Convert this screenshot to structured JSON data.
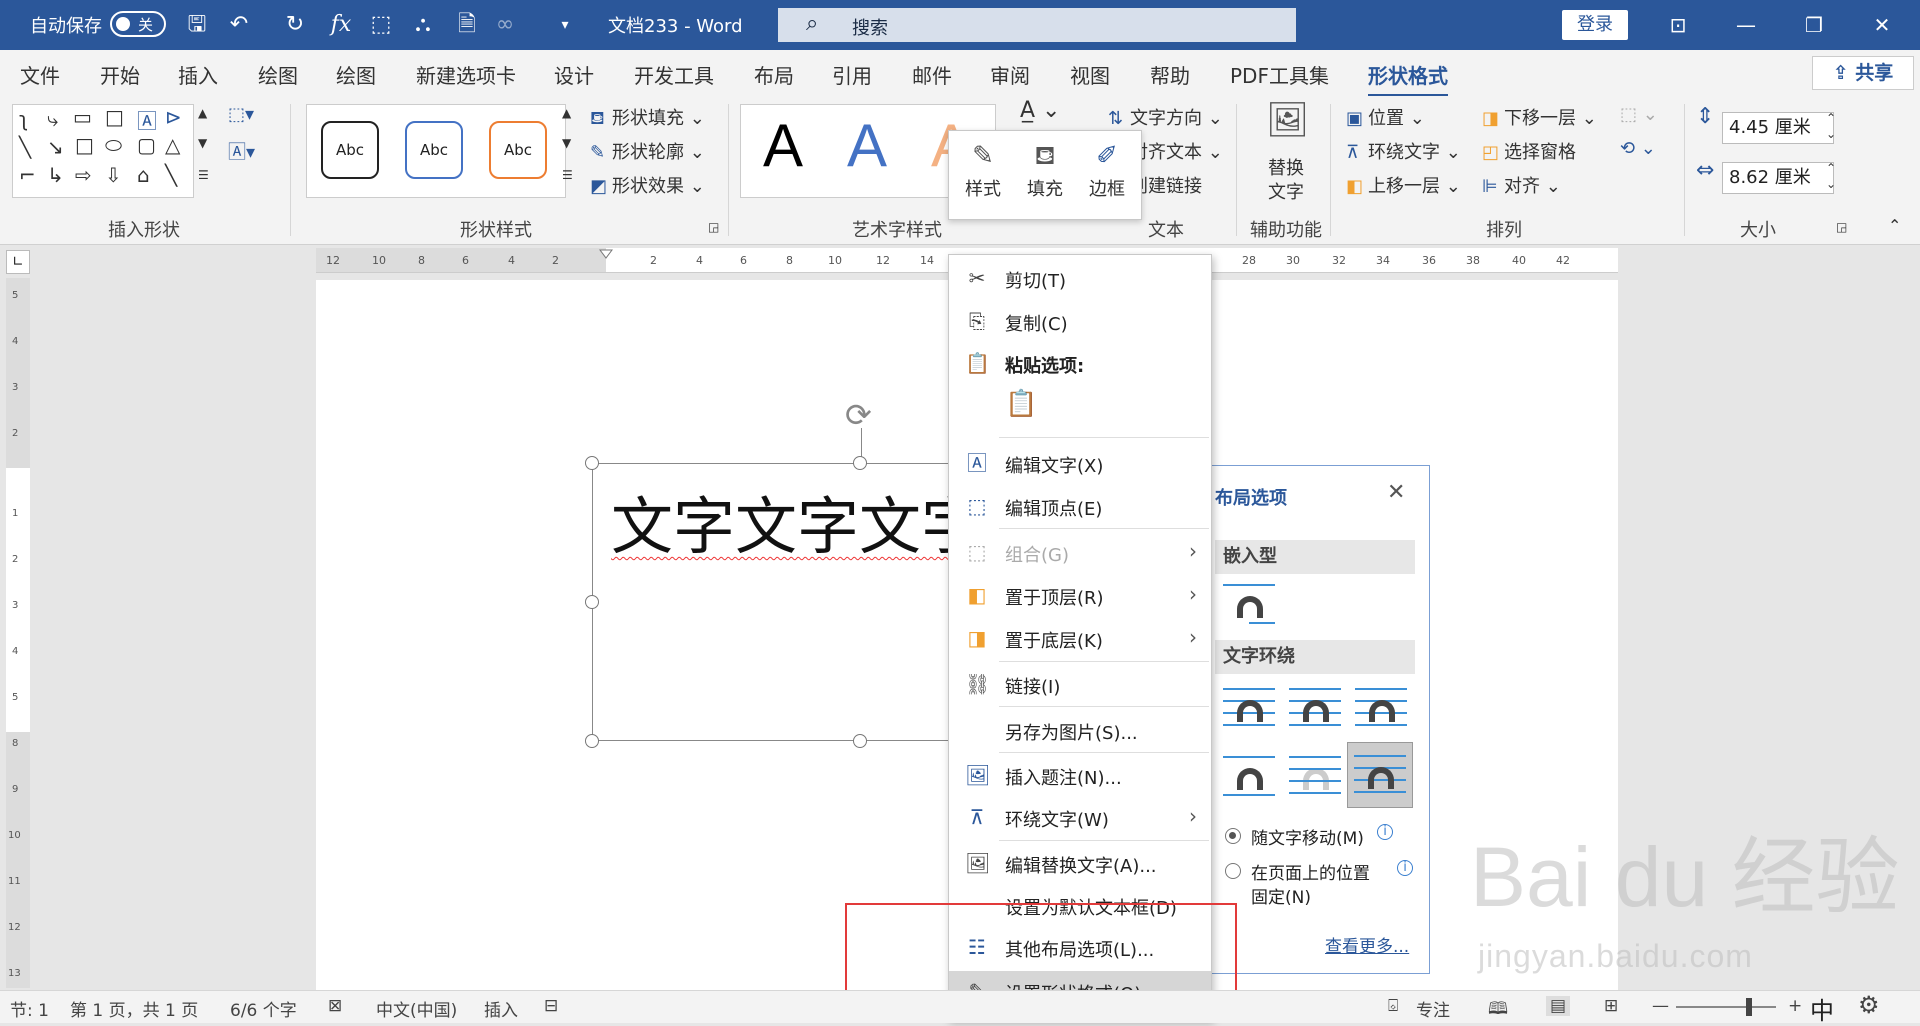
{
  "titlebar": {
    "autosave_label": "自动保存",
    "autosave_state": "关",
    "doc_title": "文档233  -  Word",
    "search_placeholder": "搜索",
    "login": "登录"
  },
  "menu_tabs": [
    "文件",
    "开始",
    "插入",
    "绘图",
    "绘图",
    "新建选项卡",
    "设计",
    "开发工具",
    "布局",
    "引用",
    "邮件",
    "审阅",
    "视图",
    "帮助",
    "PDF工具集",
    "形状格式"
  ],
  "active_tab": "形状格式",
  "share_label": "共享",
  "ribbon": {
    "insert_shapes_label": "插入形状",
    "shape_styles_label": "形状样式",
    "shape_style_samples": [
      "Abc",
      "Abc",
      "Abc"
    ],
    "shape_fill": "形状填充",
    "shape_outline": "形状轮廓",
    "shape_effects": "形状效果",
    "wordart_label": "艺术字样式",
    "text_direction": "文字方向",
    "align_text": "对齐文本",
    "create_link": "创建链接",
    "text_label": "文本",
    "alt_text_line1": "替换",
    "alt_text_line2": "文字",
    "accessibility_label": "辅助功能",
    "position": "位置",
    "wrap_text": "环绕文字",
    "bring_forward": "上移一层",
    "send_backward": "下移一层",
    "selection_pane": "选择窗格",
    "align": "对齐",
    "arrange_label": "排列",
    "height_value": "4.45 厘米",
    "width_value": "8.62 厘米",
    "size_label": "大小"
  },
  "mini_toolbar": {
    "style": "样式",
    "fill": "填充",
    "outline": "边框"
  },
  "document": {
    "textbox_text": "文字文字文字"
  },
  "context_menu": {
    "cut": "剪切(T)",
    "copy": "复制(C)",
    "paste_options": "粘贴选项:",
    "edit_text": "编辑文字(X)",
    "edit_points": "编辑顶点(E)",
    "group": "组合(G)",
    "bring_to_front": "置于顶层(R)",
    "send_to_back": "置于底层(K)",
    "link": "链接(I)",
    "save_as_picture": "另存为图片(S)...",
    "insert_caption": "插入题注(N)...",
    "wrap_text": "环绕文字(W)",
    "edit_alt_text": "编辑替换文字(A)...",
    "set_default_textbox": "设置为默认文本框(D)",
    "more_layout_options": "其他布局选项(L)...",
    "format_shape": "设置形状格式(O)..."
  },
  "layout_panel": {
    "title": "布局选项",
    "inline_section": "嵌入型",
    "wrap_section": "文字环绕",
    "move_with_text": "随文字移动(M)",
    "fix_position_line1": "在页面上的位置",
    "fix_position_line2": "固定(N)",
    "see_more": "查看更多..."
  },
  "watermark": {
    "brand": "Bai   du 经验",
    "url": "jingyan.baidu.com"
  },
  "statusbar": {
    "section": "节: 1",
    "page": "第 1 页，共 1 页",
    "words": "6/6 个字",
    "language": "中文(中国)",
    "mode": "插入",
    "focus": "专注",
    "ime": "中"
  }
}
